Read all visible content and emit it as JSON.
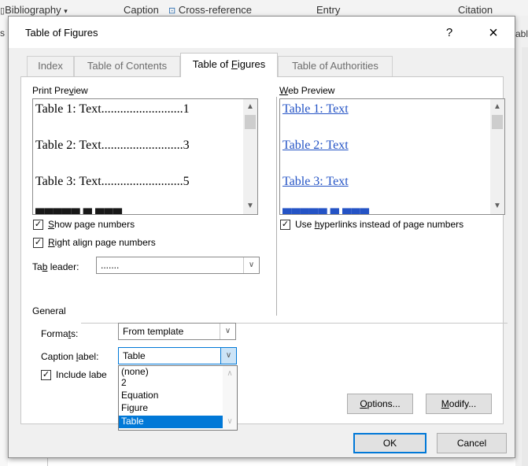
{
  "background": {
    "ribbon_items": [
      "Bibliography",
      "Caption",
      "Cross-reference",
      "Entry",
      "Citation"
    ],
    "left_fragment": "s",
    "right_fragment": "abl"
  },
  "dialog": {
    "title": "Table of Figures",
    "help_label": "?",
    "close_label": "×"
  },
  "tabs": [
    {
      "label": "Index",
      "active": false
    },
    {
      "label": "Table of Contents",
      "active": false
    },
    {
      "label": "Table of Figures",
      "active": true
    },
    {
      "label": "Table of Authorities",
      "active": false
    }
  ],
  "print_preview": {
    "label": "Print Preview",
    "lines": [
      {
        "entry": "Table 1: Text",
        "leader": "..........................",
        "page": "1"
      },
      {
        "entry": "Table 2: Text",
        "leader": "..........................",
        "page": "3"
      },
      {
        "entry": "Table 3: Text",
        "leader": "..........................",
        "page": "5"
      }
    ]
  },
  "web_preview": {
    "label": "Web Preview",
    "links": [
      "Table 1: Text",
      "Table 2: Text",
      "Table 3: Text"
    ]
  },
  "options": {
    "show_page_numbers": {
      "label": "Show page numbers",
      "checked": true
    },
    "right_align": {
      "label": "Right align page numbers",
      "checked": true
    },
    "use_hyperlinks": {
      "label": "Use hyperlinks instead of page numbers",
      "checked": true
    },
    "tab_leader": {
      "label": "Tab leader:",
      "value": "......."
    }
  },
  "general": {
    "label": "General",
    "formats": {
      "label": "Formats:",
      "value": "From template"
    },
    "caption_label": {
      "label": "Caption label:",
      "value": "Table"
    },
    "include_label": {
      "label": "Include labe",
      "checked": true
    },
    "caption_options": [
      "(none)",
      "2",
      "Equation",
      "Figure",
      "Table"
    ],
    "selected_option": "Table"
  },
  "buttons": {
    "options": "Options...",
    "modify": "Modify...",
    "ok": "OK",
    "cancel": "Cancel"
  },
  "colors": {
    "accent": "#0078d7",
    "hyperlink": "#2453c5"
  }
}
